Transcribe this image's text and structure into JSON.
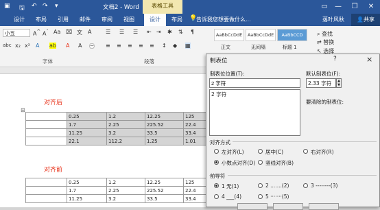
{
  "titlebar": {
    "doc_title": "文档2 - Word",
    "context_group": "表格工具",
    "minimize": "—",
    "restore": "❐",
    "close": "✕",
    "ribbon_display": "▭"
  },
  "tabs": [
    "设计",
    "布局",
    "引用",
    "邮件",
    "审阅",
    "视图"
  ],
  "context_tabs": {
    "design": "设计",
    "layout": "布局"
  },
  "search_tip": "告诉我您想要做什么...",
  "user": "落叶风秋",
  "share": "共享",
  "ribbon": {
    "font_size": "小五",
    "font_group": "字体",
    "paragraph_group": "段落",
    "styles": [
      {
        "sample": "AaBbCcDdE",
        "name": "正文"
      },
      {
        "sample": "AaBbCcDdE",
        "name": "无间隔"
      },
      {
        "sample": "AaBbCCD",
        "name": "标题 1"
      }
    ],
    "find": "查找",
    "replace": "替换",
    "select": "选择"
  },
  "document": {
    "heading_after": "对齐后",
    "heading_before": "对齐前",
    "table_after": [
      [
        "0.25",
        "1.2",
        "12.25",
        "125"
      ],
      [
        "1.7",
        "2.25",
        "225.52",
        "22.4"
      ],
      [
        "11.25",
        "3.2",
        "33.5",
        "33.4"
      ],
      [
        "22.1",
        "112.2",
        "1.25",
        "1.01"
      ]
    ],
    "table_before": [
      [
        "0.25",
        "1.2",
        "12.25",
        "125"
      ],
      [
        "1.7",
        "2.25",
        "225.52",
        "22.4"
      ],
      [
        "11.25",
        "3.2",
        "33.5",
        "33.4"
      ]
    ]
  },
  "dialog": {
    "title": "制表位",
    "help": "?",
    "close": "×",
    "tab_position_label": "制表位位置(T):",
    "tab_position_value": "2 字符",
    "tab_list": [
      "2 字符"
    ],
    "default_tab_label": "默认制表位(F):",
    "default_tab_value": "2.33 字符",
    "clear_label": "要清除的制表位:",
    "alignment_label": "对齐方式",
    "alignment_options": [
      {
        "label": "左对齐(L)",
        "selected": false
      },
      {
        "label": "居中(C)",
        "selected": false
      },
      {
        "label": "右对齐(R)",
        "selected": false
      },
      {
        "label": "小数点对齐(D)",
        "selected": true
      },
      {
        "label": "竖线对齐(B)",
        "selected": false
      }
    ],
    "leader_label": "前导符",
    "leader_options": [
      {
        "label": "1 无(1)",
        "selected": true
      },
      {
        "label": "2 .......(2)",
        "selected": false
      },
      {
        "label": "3 --------(3)",
        "selected": false
      },
      {
        "label": "4 ___(4)",
        "selected": false
      },
      {
        "label": "5 ·······(5)",
        "selected": false
      }
    ]
  }
}
